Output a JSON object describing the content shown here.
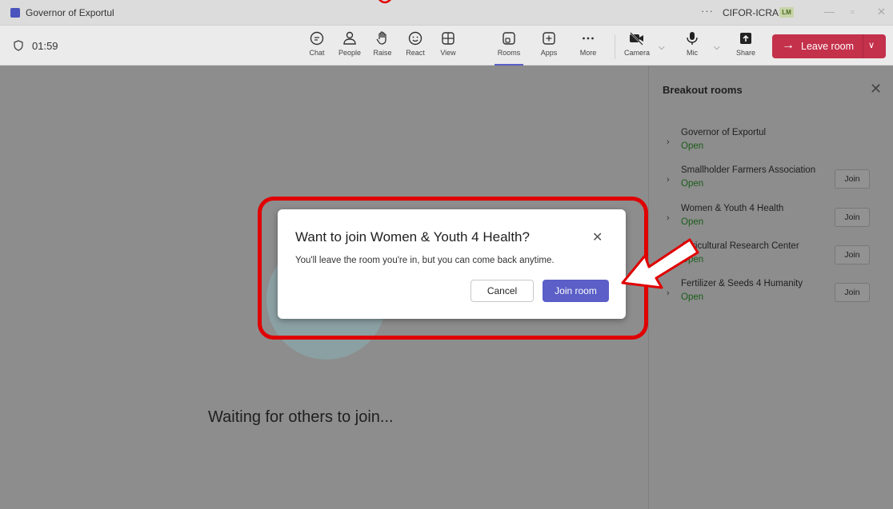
{
  "window": {
    "title": "Governor of Exportul",
    "more": "···",
    "org": "CIFOR-ICRAF",
    "avatar_initials": "LM"
  },
  "toolbar": {
    "timer": "01:59",
    "buttons": [
      {
        "label": "Chat",
        "icon": "chat-icon"
      },
      {
        "label": "People",
        "icon": "people-icon"
      },
      {
        "label": "Raise",
        "icon": "raise-hand-icon"
      },
      {
        "label": "React",
        "icon": "react-icon"
      },
      {
        "label": "View",
        "icon": "view-icon"
      },
      {
        "label": "Rooms",
        "icon": "rooms-icon",
        "active": true
      },
      {
        "label": "Apps",
        "icon": "apps-icon"
      },
      {
        "label": "More",
        "icon": "more-icon"
      },
      {
        "label": "Camera",
        "icon": "camera-off-icon"
      },
      {
        "label": "Mic",
        "icon": "mic-icon"
      },
      {
        "label": "Share",
        "icon": "share-icon"
      }
    ],
    "leave_label": "Leave room"
  },
  "stage": {
    "waiting_text": "Waiting for others to join..."
  },
  "panel": {
    "title": "Breakout rooms",
    "rooms": [
      {
        "name": "Governor of Exportul",
        "status": "Open"
      },
      {
        "name": "Smallholder Farmers Association",
        "status": "Open",
        "join": "Join"
      },
      {
        "name": "Women & Youth 4 Health",
        "status": "Open",
        "join": "Join"
      },
      {
        "name": "Agricultural Research Center",
        "status": "Open",
        "join": "Join"
      },
      {
        "name": "Fertilizer & Seeds 4 Humanity",
        "status": "Open",
        "join": "Join"
      }
    ]
  },
  "dialog": {
    "title": "Want to join Women & Youth 4 Health?",
    "body": "You'll leave the room you're in, but you can come back anytime.",
    "cancel_label": "Cancel",
    "join_label": "Join room"
  },
  "colors": {
    "accent": "#5b5fc7",
    "leave": "#c4314b",
    "highlight": "#e00000",
    "open_status": "#1a5c1a"
  }
}
